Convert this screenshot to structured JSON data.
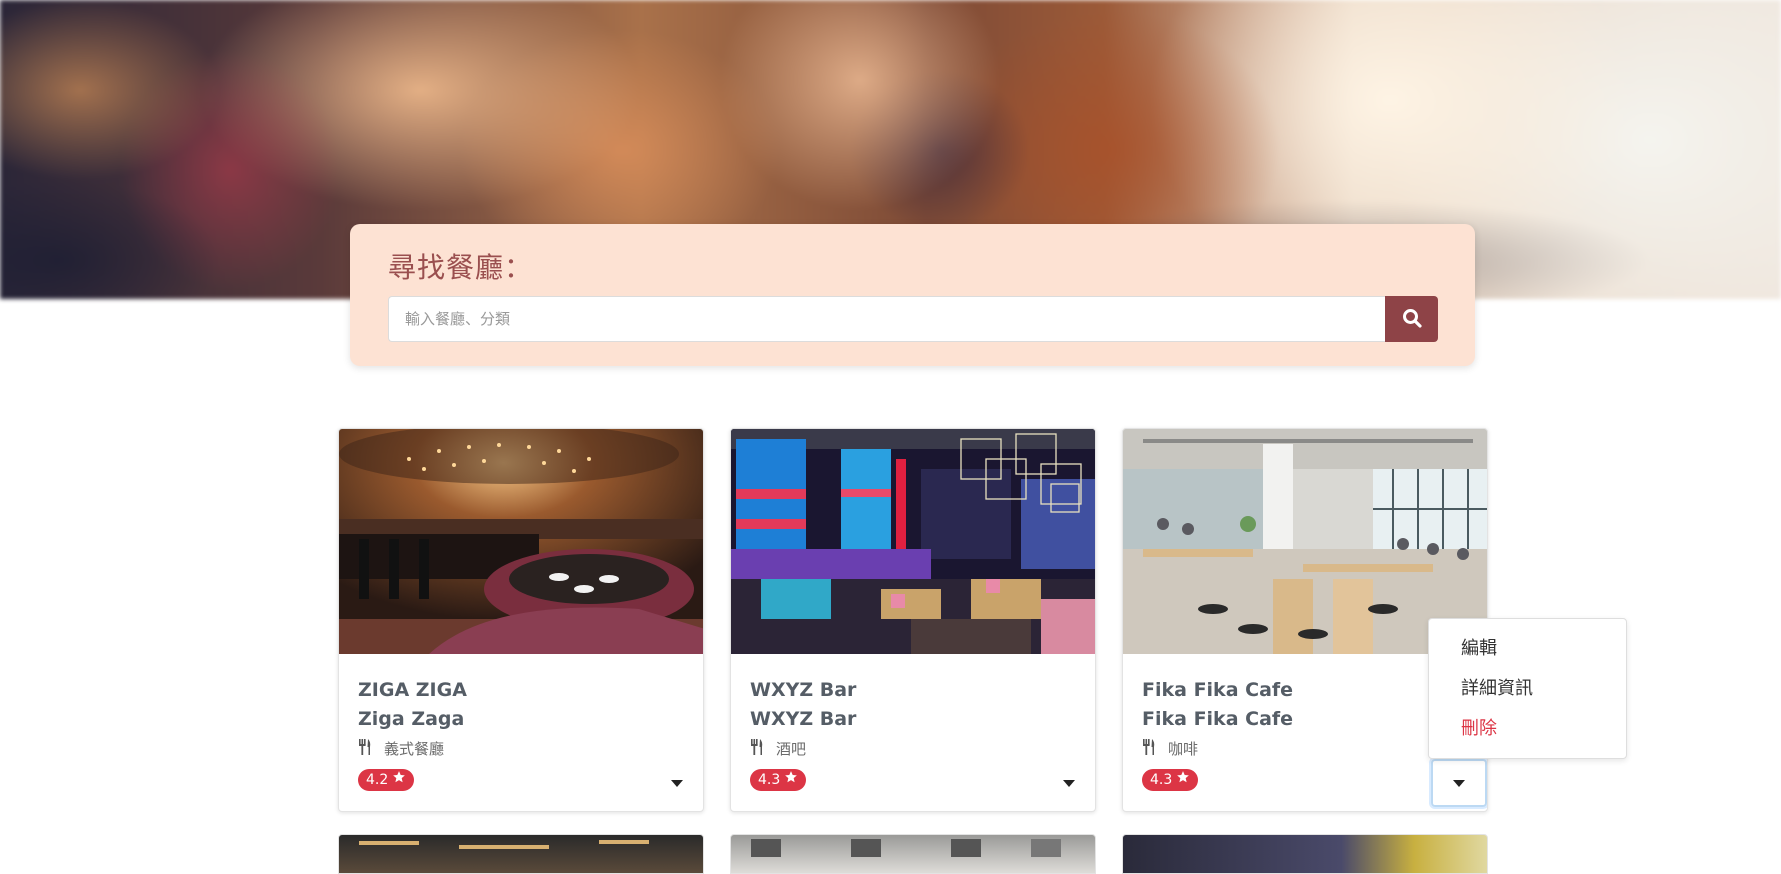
{
  "search": {
    "title": "尋找餐廳：",
    "placeholder": "輸入餐廳、分類",
    "value": ""
  },
  "restaurants": [
    {
      "name": "ZIGA ZIGA",
      "name_en": "Ziga Zaga",
      "category": "義式餐廳",
      "rating": "4.2"
    },
    {
      "name": "WXYZ Bar",
      "name_en": "WXYZ Bar",
      "category": "酒吧",
      "rating": "4.3"
    },
    {
      "name": "Fika Fika Cafe",
      "name_en": "Fika Fika Cafe",
      "category": "咖啡",
      "rating": "4.3"
    }
  ],
  "dropdown": {
    "items": [
      {
        "label": "編輯"
      },
      {
        "label": "詳細資訊"
      },
      {
        "label": "刪除"
      }
    ]
  },
  "colors": {
    "accent": "#8e4347",
    "panel": "#fde2d3",
    "rating_badge": "#dc3545",
    "delete_text": "#dc3545"
  },
  "icons": {
    "search_button": "search-icon",
    "category": "utensils-icon",
    "rating": "star-icon",
    "dropdown": "caret-down-icon"
  }
}
